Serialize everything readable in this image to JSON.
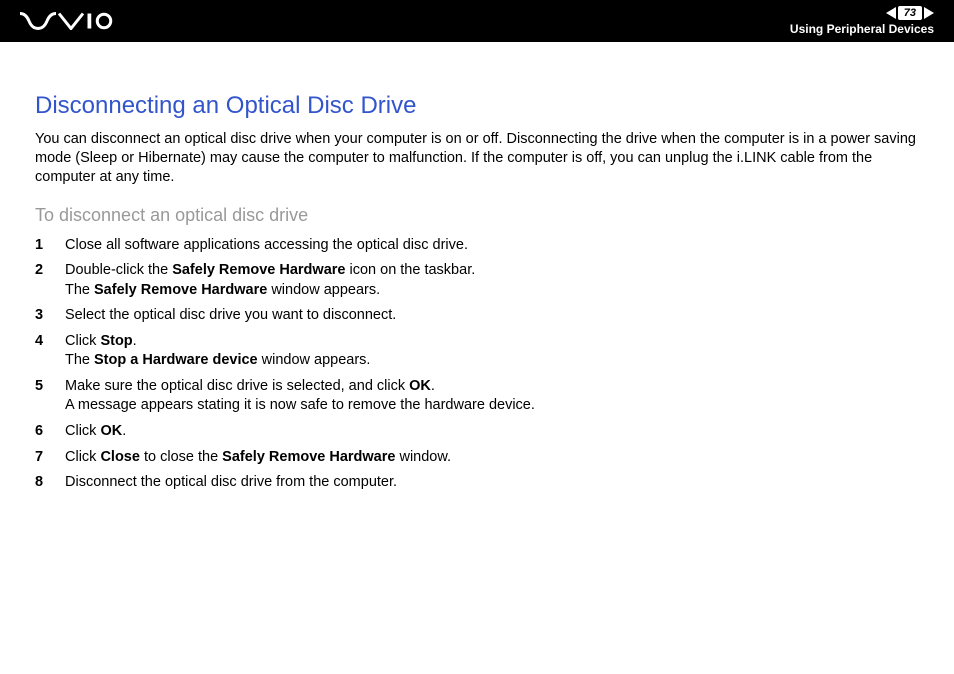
{
  "header": {
    "page_number": "73",
    "section": "Using Peripheral Devices"
  },
  "title": "Disconnecting an Optical Disc Drive",
  "intro": "You can disconnect an optical disc drive when your computer is on or off. Disconnecting the drive when the computer is in a power saving mode (Sleep or Hibernate) may cause the computer to malfunction. If the computer is off, you can unplug the i.LINK cable from the computer at any time.",
  "subtitle": "To disconnect an optical disc drive",
  "steps": [
    {
      "num": "1",
      "parts": [
        {
          "text": "Close all software applications accessing the optical disc drive.",
          "bold": false
        }
      ]
    },
    {
      "num": "2",
      "parts": [
        {
          "text": "Double-click the ",
          "bold": false
        },
        {
          "text": "Safely Remove Hardware",
          "bold": true
        },
        {
          "text": " icon on the taskbar.",
          "bold": false
        },
        {
          "text": "\n",
          "bold": false
        },
        {
          "text": "The ",
          "bold": false
        },
        {
          "text": "Safely Remove Hardware",
          "bold": true
        },
        {
          "text": " window appears.",
          "bold": false
        }
      ]
    },
    {
      "num": "3",
      "parts": [
        {
          "text": "Select the optical disc drive you want to disconnect.",
          "bold": false
        }
      ]
    },
    {
      "num": "4",
      "parts": [
        {
          "text": "Click ",
          "bold": false
        },
        {
          "text": "Stop",
          "bold": true
        },
        {
          "text": ".",
          "bold": false
        },
        {
          "text": "\n",
          "bold": false
        },
        {
          "text": "The ",
          "bold": false
        },
        {
          "text": "Stop a Hardware device",
          "bold": true
        },
        {
          "text": " window appears.",
          "bold": false
        }
      ]
    },
    {
      "num": "5",
      "parts": [
        {
          "text": "Make sure the optical disc drive is selected, and click ",
          "bold": false
        },
        {
          "text": "OK",
          "bold": true
        },
        {
          "text": ".",
          "bold": false
        },
        {
          "text": "\n",
          "bold": false
        },
        {
          "text": "A message appears stating it is now safe to remove the hardware device.",
          "bold": false
        }
      ]
    },
    {
      "num": "6",
      "parts": [
        {
          "text": "Click ",
          "bold": false
        },
        {
          "text": "OK",
          "bold": true
        },
        {
          "text": ".",
          "bold": false
        }
      ]
    },
    {
      "num": "7",
      "parts": [
        {
          "text": "Click ",
          "bold": false
        },
        {
          "text": "Close",
          "bold": true
        },
        {
          "text": " to close the ",
          "bold": false
        },
        {
          "text": "Safely Remove Hardware",
          "bold": true
        },
        {
          "text": " window.",
          "bold": false
        }
      ]
    },
    {
      "num": "8",
      "parts": [
        {
          "text": "Disconnect the optical disc drive from the computer.",
          "bold": false
        }
      ]
    }
  ]
}
